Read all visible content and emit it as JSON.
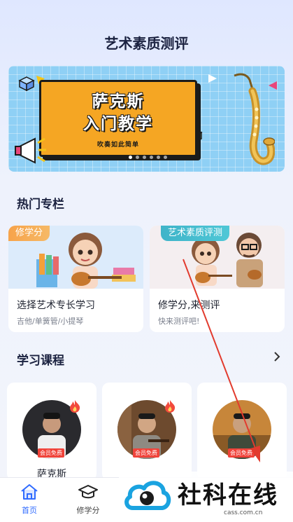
{
  "header": {
    "title": "艺术素质测评"
  },
  "banner": {
    "line1": "萨克斯",
    "line2": "入门教学",
    "sub": "吹奏如此简单",
    "dots": 6,
    "active_dot": 0
  },
  "hot": {
    "title": "热门专栏",
    "cards": [
      {
        "tag": "修学分",
        "name": "选择艺术专长学习",
        "desc": "吉他/单簧管/小提琴"
      },
      {
        "tag": "艺术素质评测",
        "name": "修学分,来测评",
        "desc": "快来测评吧!"
      }
    ]
  },
  "courses": {
    "title": "学习课程",
    "more_icon": "chevron-right-icon",
    "items": [
      {
        "badge": "会员免费",
        "name": "萨克斯"
      },
      {
        "badge": "会员免费",
        "name": ""
      },
      {
        "badge": "会员免费",
        "name": ""
      }
    ]
  },
  "tabbar": {
    "items": [
      {
        "label": "首页",
        "icon": "home-icon",
        "active": true
      },
      {
        "label": "修学分",
        "icon": "graduation-cap-icon",
        "active": false
      }
    ]
  },
  "watermark": {
    "text": "社科在线",
    "url": "cass.com.cn"
  },
  "colors": {
    "accent": "#2f6bff",
    "banner_bg": "#8fd0f5",
    "badge": "#f0433a",
    "tag_orange": "#f7a34a",
    "tag_blue": "#3fb4c9"
  }
}
